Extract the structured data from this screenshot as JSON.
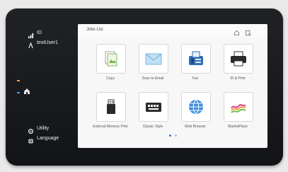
{
  "sidebar": {
    "status_id": "ID",
    "user": "testUser1",
    "utility": "Utility",
    "language": "Language"
  },
  "header": {
    "jobs_label": "Jobs List"
  },
  "apps": [
    {
      "label": "Copy"
    },
    {
      "label": "Scan to Email"
    },
    {
      "label": "Fax"
    },
    {
      "label": "ID & Print"
    },
    {
      "label": "External Memory Print"
    },
    {
      "label": "Classic Style"
    },
    {
      "label": "Web Browser"
    },
    {
      "label": "MarketPlace"
    }
  ],
  "pagination": {
    "pages": 2,
    "current": 1,
    "active_color": "#3a7bd5",
    "inactive_color": "#bcbcbc"
  },
  "colors": {
    "bezel": "#121417",
    "screen": "#f7f7f8",
    "led_orange": "#f5a53a",
    "led_blue": "#3aa0ff"
  },
  "icons": [
    "signal-icon",
    "user-icon",
    "gear-icon",
    "globe-icon",
    "home-icon",
    "log-icon",
    "printer-icon",
    "fax-icon",
    "usb-icon",
    "keyboard-icon",
    "envelope-icon",
    "copy-icon",
    "marketplace-icon"
  ]
}
